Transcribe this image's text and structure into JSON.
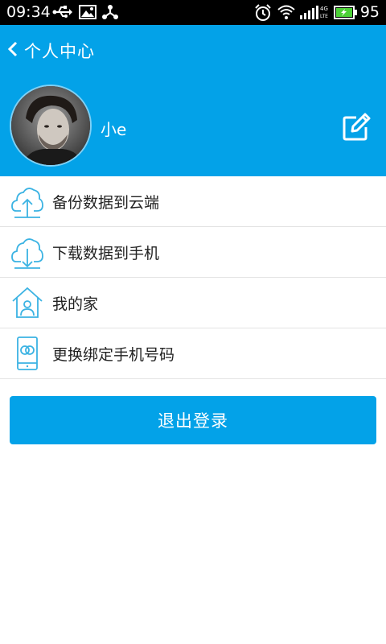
{
  "status_bar": {
    "time": "09:34",
    "battery": "95",
    "icons": [
      "usb-icon",
      "image-icon",
      "share-icon",
      "alarm-icon",
      "wifi-icon",
      "signal-icon",
      "battery-icon"
    ]
  },
  "header": {
    "title": "个人中心",
    "back_icon": "chevron-left-icon",
    "edit_icon": "edit-icon",
    "username": "小e",
    "background": "#03a2e8"
  },
  "menu": {
    "items": [
      {
        "label": "备份数据到云端",
        "icon": "cloud-upload-icon"
      },
      {
        "label": "下载数据到手机",
        "icon": "cloud-download-icon"
      },
      {
        "label": "我的家",
        "icon": "home-user-icon"
      },
      {
        "label": "更换绑定手机号码",
        "icon": "phone-bind-icon"
      }
    ]
  },
  "logout": {
    "label": "退出登录"
  },
  "colors": {
    "accent": "#03a2e8",
    "icon_line": "#3bb3e3"
  }
}
